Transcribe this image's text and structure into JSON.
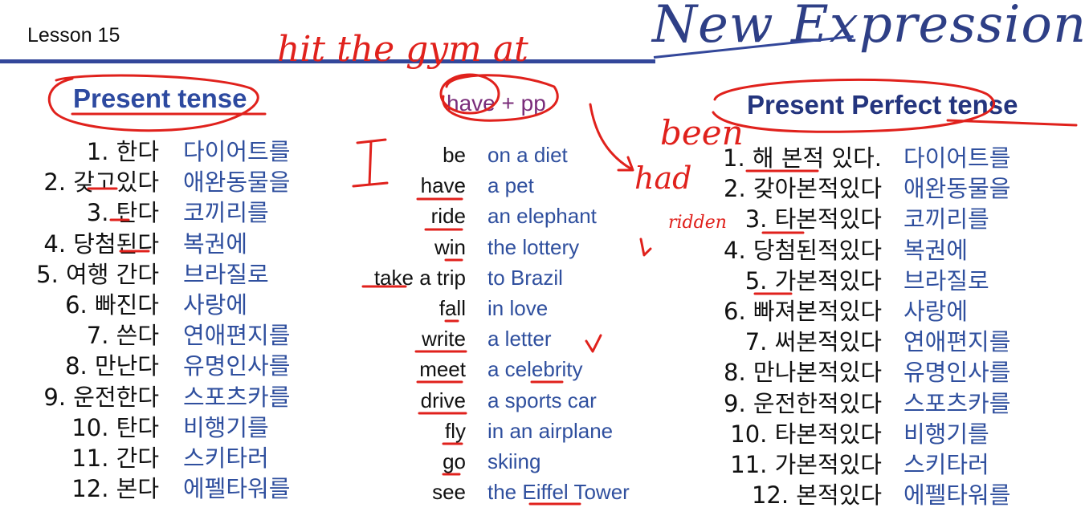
{
  "header": {
    "lesson": "Lesson 15",
    "brand": "New Expressions"
  },
  "columns": {
    "present_title": "Present tense",
    "middle_title": "have + pp",
    "perfect_title": "Present Perfect tense"
  },
  "present": [
    {
      "num": "1.",
      "verb": "한다",
      "obj": "다이어트를"
    },
    {
      "num": "2.",
      "verb": "갖고있다",
      "obj": "애완동물을"
    },
    {
      "num": "3.",
      "verb": "탄다",
      "obj": "코끼리를"
    },
    {
      "num": "4.",
      "verb": "당첨된다",
      "obj": "복권에"
    },
    {
      "num": "5.",
      "verb": "여행 간다",
      "obj": "브라질로"
    },
    {
      "num": "6.",
      "verb": "빠진다",
      "obj": "사랑에"
    },
    {
      "num": "7.",
      "verb": "쓴다",
      "obj": "연애편지를"
    },
    {
      "num": "8.",
      "verb": "만난다",
      "obj": "유명인사를"
    },
    {
      "num": "9.",
      "verb": "운전한다",
      "obj": "스포츠카를"
    },
    {
      "num": "10.",
      "verb": "탄다",
      "obj": "비행기를"
    },
    {
      "num": "11.",
      "verb": "간다",
      "obj": "스키타러"
    },
    {
      "num": "12.",
      "verb": "본다",
      "obj": "에펠타워를"
    }
  ],
  "english": [
    {
      "verb": "be",
      "obj": "on a diet"
    },
    {
      "verb": "have",
      "obj": "a pet"
    },
    {
      "verb": "ride",
      "obj": "an elephant"
    },
    {
      "verb": "win",
      "obj": "the lottery"
    },
    {
      "verb": "take a trip",
      "obj": "to Brazil"
    },
    {
      "verb": "fall",
      "obj": "in love"
    },
    {
      "verb": "write",
      "obj": "a letter"
    },
    {
      "verb": "meet",
      "obj": "a celebrity"
    },
    {
      "verb": "drive",
      "obj": "a sports car"
    },
    {
      "verb": "fly",
      "obj": "in an airplane"
    },
    {
      "verb": "go",
      "obj": "skiing"
    },
    {
      "verb": "see",
      "obj": "the Eiffel Tower"
    }
  ],
  "perfect": [
    {
      "num": "1.",
      "verb": "해 본적 있다.",
      "obj": "다이어트를"
    },
    {
      "num": "2.",
      "verb": "갖아본적있다",
      "obj": "애완동물을"
    },
    {
      "num": "3.",
      "verb": "타본적있다",
      "obj": "코끼리를"
    },
    {
      "num": "4.",
      "verb": "당첨된적있다",
      "obj": "복권에"
    },
    {
      "num": "5.",
      "verb": "가본적있다",
      "obj": "브라질로"
    },
    {
      "num": "6.",
      "verb": "빠져본적있다",
      "obj": "사랑에"
    },
    {
      "num": "7.",
      "verb": "써본적있다",
      "obj": "연애편지를"
    },
    {
      "num": "8.",
      "verb": "만나본적있다",
      "obj": "유명인사를"
    },
    {
      "num": "9.",
      "verb": "운전한적있다",
      "obj": "스포츠카를"
    },
    {
      "num": "10.",
      "verb": "타본적있다",
      "obj": "비행기를"
    },
    {
      "num": "11.",
      "verb": "가본적있다",
      "obj": "스키타러"
    },
    {
      "num": "12.",
      "verb": "본적있다",
      "obj": "에펠타워를"
    }
  ],
  "handwriting": {
    "line1": "hit the gym at",
    "been": "been",
    "had": "had",
    "I": "I",
    "ridden": "ridden"
  },
  "colors": {
    "ink_red": "#e0211c",
    "brand_blue": "#2e3f86",
    "text_blue": "#2f4f9e"
  }
}
